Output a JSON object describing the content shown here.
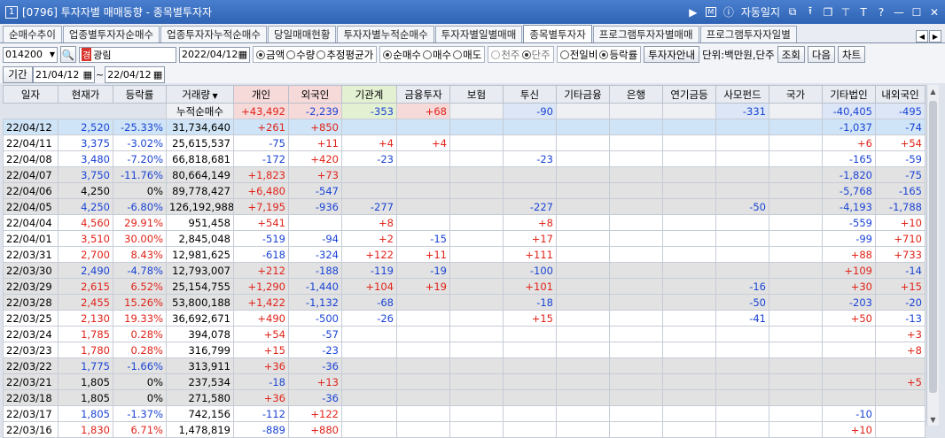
{
  "window": {
    "number": "1",
    "title": "[0796] 투자자별 매매동향 - 종목별투자자",
    "right_icons": [
      "play-icon",
      "memo-icon"
    ],
    "memo_label": "M",
    "autolog_label": "자동일지"
  },
  "tabs": [
    {
      "label": "순매수추이"
    },
    {
      "label": "업종별투자자순매수"
    },
    {
      "label": "업종투자자누적순매수"
    },
    {
      "label": "당일매매현황"
    },
    {
      "label": "투자자별누적순매수"
    },
    {
      "label": "투자자별일별매매"
    },
    {
      "label": "종목별투자자",
      "active": true
    },
    {
      "label": "프로그램투자자별매매"
    },
    {
      "label": "프로그램투자자일별"
    }
  ],
  "toolbar": {
    "code": "014200",
    "stock_tag": "경",
    "stock_name": "광림",
    "date": "2022/04/12",
    "radio1": [
      {
        "label": "금액",
        "on": true
      },
      {
        "label": "수량",
        "on": false
      },
      {
        "label": "추정평균가",
        "on": false
      }
    ],
    "radio2": [
      {
        "label": "순매수",
        "on": true
      },
      {
        "label": "매수",
        "on": false
      },
      {
        "label": "매도",
        "on": false
      }
    ],
    "radio3": [
      {
        "label": "천주",
        "on": false
      },
      {
        "label": "단주",
        "on": true
      }
    ],
    "radio4": [
      {
        "label": "전일비",
        "on": false
      },
      {
        "label": "등락률",
        "on": true
      }
    ],
    "guide_button": "투자자안내",
    "unit_label": "단위:백만원,단주",
    "search_button": "조회",
    "next_button": "다음",
    "chart_button": "차트"
  },
  "period": {
    "label": "기간",
    "from": "21/04/12",
    "to": "22/04/12",
    "cumulative_label": "누적순매수",
    "sums": [
      "+43,492",
      "-2,239",
      "-353",
      "+68",
      "",
      "-90",
      "",
      "",
      "",
      "-331",
      "",
      "-40,405",
      "-495"
    ]
  },
  "table": {
    "headers": [
      "일자",
      "현재가",
      "등락률",
      "거래량",
      "개인",
      "외국인",
      "기관계",
      "금융투자",
      "보험",
      "투신",
      "기타금융",
      "은행",
      "연기금등",
      "사모펀드",
      "국가",
      "기타법인",
      "내외국인"
    ],
    "rows": [
      [
        "22/04/12",
        "2,520",
        "-25.33%",
        "31,734,640",
        "+261",
        "+850",
        "",
        "",
        "",
        "",
        "",
        "",
        "",
        "",
        "",
        "-1,037",
        "-74"
      ],
      [
        "22/04/11",
        "3,375",
        "-3.02%",
        "25,615,537",
        "-75",
        "+11",
        "+4",
        "+4",
        "",
        "",
        "",
        "",
        "",
        "",
        "",
        "+6",
        "+54"
      ],
      [
        "22/04/08",
        "3,480",
        "-7.20%",
        "66,818,681",
        "-172",
        "+420",
        "-23",
        "",
        "",
        "-23",
        "",
        "",
        "",
        "",
        "",
        "-165",
        "-59"
      ],
      [
        "22/04/07",
        "3,750",
        "-11.76%",
        "80,664,149",
        "+1,823",
        "+73",
        "",
        "",
        "",
        "",
        "",
        "",
        "",
        "",
        "",
        "-1,820",
        "-75"
      ],
      [
        "22/04/06",
        "4,250",
        "0%",
        "89,778,427",
        "+6,480",
        "-547",
        "",
        "",
        "",
        "",
        "",
        "",
        "",
        "",
        "",
        "-5,768",
        "-165"
      ],
      [
        "22/04/05",
        "4,250",
        "-6.80%",
        "126,192,988",
        "+7,195",
        "-936",
        "-277",
        "",
        "",
        "-227",
        "",
        "",
        "",
        "-50",
        "",
        "-4,193",
        "-1,788"
      ],
      [
        "22/04/04",
        "4,560",
        "29.91%",
        "951,458",
        "+541",
        "",
        "+8",
        "",
        "",
        "+8",
        "",
        "",
        "",
        "",
        "",
        "-559",
        "+10"
      ],
      [
        "22/04/01",
        "3,510",
        "30.00%",
        "2,845,048",
        "-519",
        "-94",
        "+2",
        "-15",
        "",
        "+17",
        "",
        "",
        "",
        "",
        "",
        "-99",
        "+710"
      ],
      [
        "22/03/31",
        "2,700",
        "8.43%",
        "12,981,625",
        "-618",
        "-324",
        "+122",
        "+11",
        "",
        "+111",
        "",
        "",
        "",
        "",
        "",
        "+88",
        "+733"
      ],
      [
        "22/03/30",
        "2,490",
        "-4.78%",
        "12,793,007",
        "+212",
        "-188",
        "-119",
        "-19",
        "",
        "-100",
        "",
        "",
        "",
        "",
        "",
        "+109",
        "-14"
      ],
      [
        "22/03/29",
        "2,615",
        "6.52%",
        "25,154,755",
        "+1,290",
        "-1,440",
        "+104",
        "+19",
        "",
        "+101",
        "",
        "",
        "",
        "-16",
        "",
        "+30",
        "+15"
      ],
      [
        "22/03/28",
        "2,455",
        "15.26%",
        "53,800,188",
        "+1,422",
        "-1,132",
        "-68",
        "",
        "",
        "-18",
        "",
        "",
        "",
        "-50",
        "",
        "-203",
        "-20"
      ],
      [
        "22/03/25",
        "2,130",
        "19.33%",
        "36,692,671",
        "+490",
        "-500",
        "-26",
        "",
        "",
        "+15",
        "",
        "",
        "",
        "-41",
        "",
        "+50",
        "-13"
      ],
      [
        "22/03/24",
        "1,785",
        "0.28%",
        "394,078",
        "+54",
        "-57",
        "",
        "",
        "",
        "",
        "",
        "",
        "",
        "",
        "",
        "",
        "+3"
      ],
      [
        "22/03/23",
        "1,780",
        "0.28%",
        "316,799",
        "+15",
        "-23",
        "",
        "",
        "",
        "",
        "",
        "",
        "",
        "",
        "",
        "",
        "+8"
      ],
      [
        "22/03/22",
        "1,775",
        "-1.66%",
        "313,911",
        "+36",
        "-36",
        "",
        "",
        "",
        "",
        "",
        "",
        "",
        "",
        "",
        "",
        ""
      ],
      [
        "22/03/21",
        "1,805",
        "0%",
        "237,534",
        "-18",
        "+13",
        "",
        "",
        "",
        "",
        "",
        "",
        "",
        "",
        "",
        "",
        "+5"
      ],
      [
        "22/03/18",
        "1,805",
        "0%",
        "271,580",
        "+36",
        "-36",
        "",
        "",
        "",
        "",
        "",
        "",
        "",
        "",
        "",
        "",
        ""
      ],
      [
        "22/03/17",
        "1,805",
        "-1.37%",
        "742,156",
        "-112",
        "+122",
        "",
        "",
        "",
        "",
        "",
        "",
        "",
        "",
        "",
        "-10",
        ""
      ],
      [
        "22/03/16",
        "1,830",
        "6.71%",
        "1,478,819",
        "-889",
        "+880",
        "",
        "",
        "",
        "",
        "",
        "",
        "",
        "",
        "",
        "+10",
        ""
      ]
    ],
    "shading": [
      "sel",
      "w",
      "w",
      "g",
      "g",
      "g",
      "w",
      "w",
      "w",
      "g",
      "g",
      "g",
      "w",
      "w",
      "w",
      "g",
      "g",
      "g",
      "w",
      "w"
    ]
  },
  "colors": {
    "up": "#e0241a",
    "down": "#1b44d4",
    "selected": "#cfe4f6",
    "shade": "#e2e2e2"
  }
}
